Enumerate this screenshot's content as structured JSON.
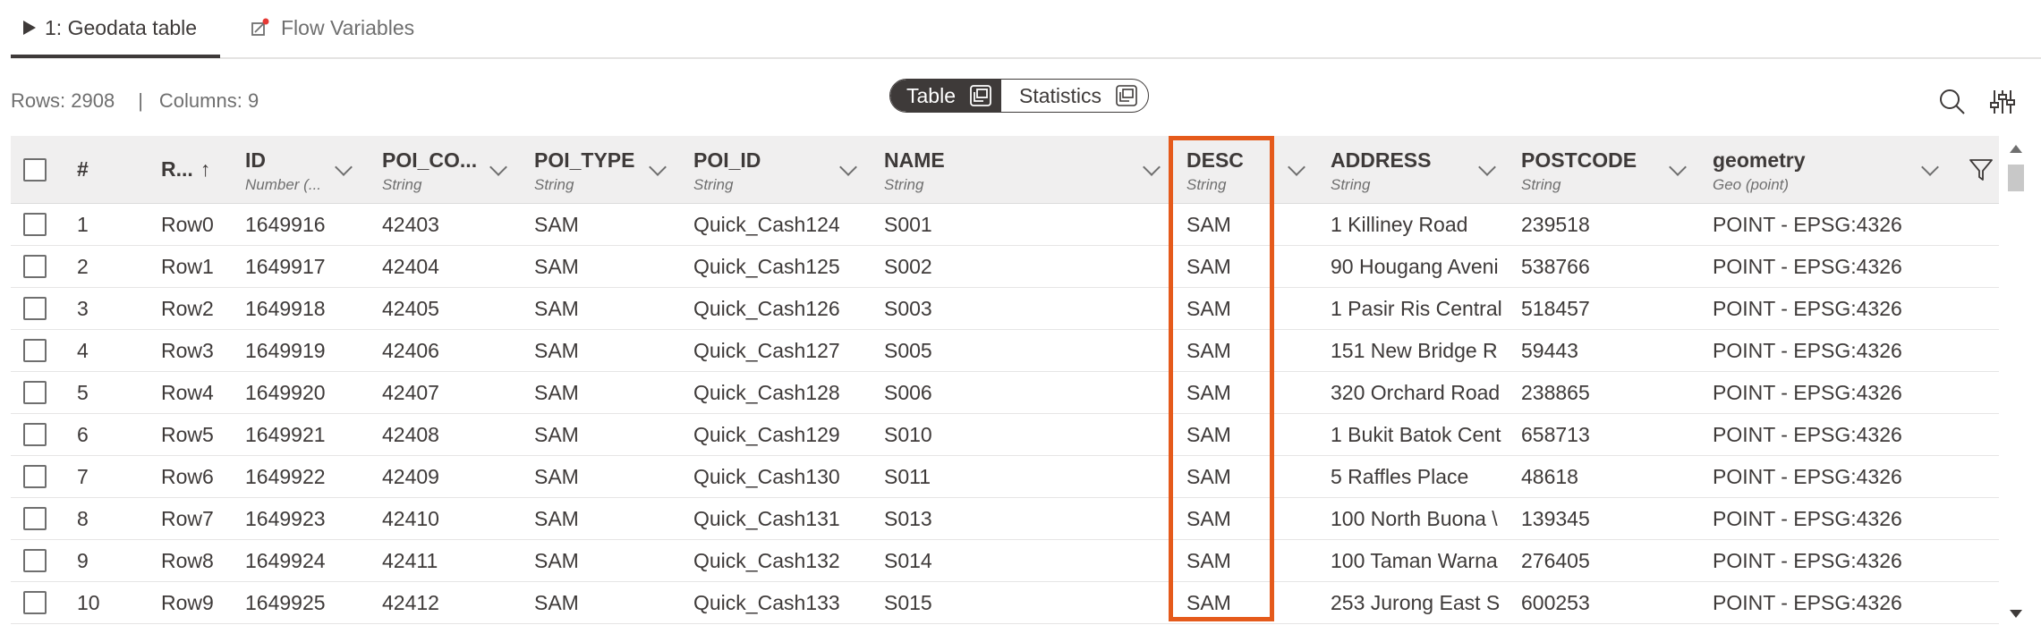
{
  "tabs": [
    {
      "label": "1: Geodata table",
      "icon": "play-icon",
      "active": true
    },
    {
      "label": "Flow Variables",
      "icon": "flow-variables-icon",
      "active": false
    }
  ],
  "toolbar": {
    "rows_label": "Rows: 2908",
    "separator": "|",
    "columns_label": "Columns: 9",
    "view_toggle": {
      "table_label": "Table",
      "statistics_label": "Statistics",
      "selected": "Table"
    }
  },
  "columns": [
    {
      "name": "#",
      "type": ""
    },
    {
      "name": "R...",
      "type": "",
      "sort": "↑"
    },
    {
      "name": "ID",
      "type": "Number (..."
    },
    {
      "name": "POI_CO...",
      "type": "String"
    },
    {
      "name": "POI_TYPE",
      "type": "String"
    },
    {
      "name": "POI_ID",
      "type": "String"
    },
    {
      "name": "NAME",
      "type": "String"
    },
    {
      "name": "DESC",
      "type": "String"
    },
    {
      "name": "ADDRESS",
      "type": "String"
    },
    {
      "name": "POSTCODE",
      "type": "String"
    },
    {
      "name": "geometry",
      "type": "Geo (point)"
    }
  ],
  "rows": [
    [
      "1",
      "Row0",
      "1649916",
      "42403",
      "SAM",
      "Quick_Cash124",
      "S001",
      "SAM",
      "1 Killiney Road",
      "239518",
      "POINT - EPSG:4326"
    ],
    [
      "2",
      "Row1",
      "1649917",
      "42404",
      "SAM",
      "Quick_Cash125",
      "S002",
      "SAM",
      "90 Hougang Aveni",
      "538766",
      "POINT - EPSG:4326"
    ],
    [
      "3",
      "Row2",
      "1649918",
      "42405",
      "SAM",
      "Quick_Cash126",
      "S003",
      "SAM",
      "1 Pasir Ris Central",
      "518457",
      "POINT - EPSG:4326"
    ],
    [
      "4",
      "Row3",
      "1649919",
      "42406",
      "SAM",
      "Quick_Cash127",
      "S005",
      "SAM",
      "151 New Bridge R",
      "59443",
      "POINT - EPSG:4326"
    ],
    [
      "5",
      "Row4",
      "1649920",
      "42407",
      "SAM",
      "Quick_Cash128",
      "S006",
      "SAM",
      "320 Orchard Road",
      "238865",
      "POINT - EPSG:4326"
    ],
    [
      "6",
      "Row5",
      "1649921",
      "42408",
      "SAM",
      "Quick_Cash129",
      "S010",
      "SAM",
      "1 Bukit Batok Cent",
      "658713",
      "POINT - EPSG:4326"
    ],
    [
      "7",
      "Row6",
      "1649922",
      "42409",
      "SAM",
      "Quick_Cash130",
      "S011",
      "SAM",
      "5 Raffles Place",
      "48618",
      "POINT - EPSG:4326"
    ],
    [
      "8",
      "Row7",
      "1649923",
      "42410",
      "SAM",
      "Quick_Cash131",
      "S013",
      "SAM",
      "100 North Buona \\",
      "139345",
      "POINT - EPSG:4326"
    ],
    [
      "9",
      "Row8",
      "1649924",
      "42411",
      "SAM",
      "Quick_Cash132",
      "S014",
      "SAM",
      "100 Taman Warna",
      "276405",
      "POINT - EPSG:4326"
    ],
    [
      "10",
      "Row9",
      "1649925",
      "42412",
      "SAM",
      "Quick_Cash133",
      "S015",
      "SAM",
      "253 Jurong East S",
      "600253",
      "POINT - EPSG:4326"
    ]
  ],
  "highlighted_column": "DESC",
  "colors": {
    "highlight": "#e55a1b",
    "text": "#3e3a39",
    "header_bg": "#f0efef"
  }
}
